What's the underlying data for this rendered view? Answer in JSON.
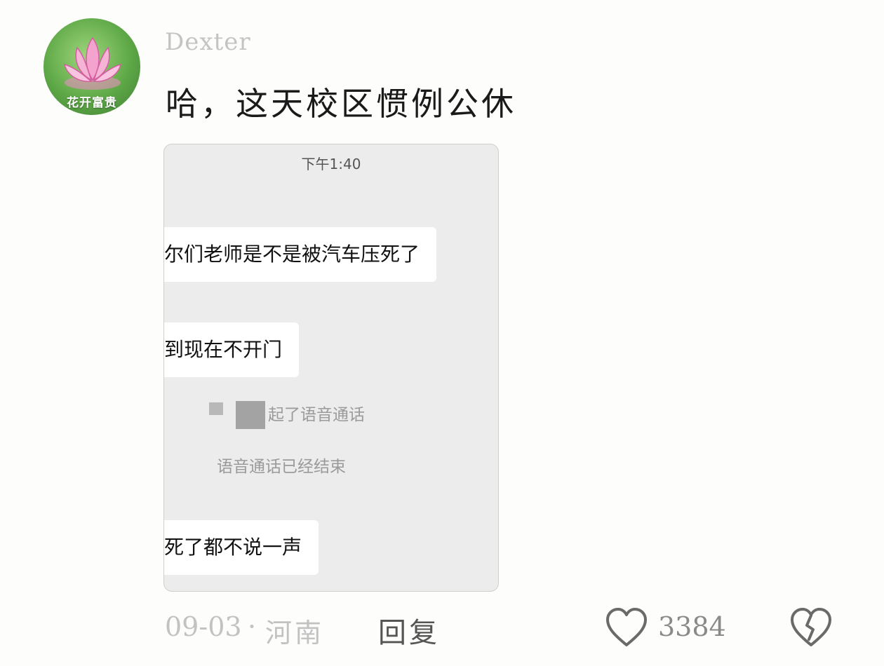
{
  "comment": {
    "avatar": {
      "caption": "花开富贵",
      "icon": "lotus-flower"
    },
    "username": "Dexter",
    "text": "哈，这天校区惯例公休",
    "image": {
      "time": "下午1:40",
      "messages": [
        "尔们老师是不是被汽车压死了",
        "到现在不开门",
        "死了都不说一声"
      ],
      "system": {
        "call_started": "起了语音通话",
        "call_ended": "语音通话已经结束"
      }
    },
    "meta": {
      "date": "09-03",
      "separator": "·",
      "region": "河南"
    },
    "actions": {
      "reply": "回复",
      "like_count": "3384",
      "like_icon": "heart-outline",
      "dislike_icon": "broken-heart"
    }
  },
  "colors": {
    "muted_text": "#c2c2c2",
    "primary_text": "#1a1a1a",
    "icon": "#6a6a6a",
    "screenshot_bg": "#ececec"
  }
}
